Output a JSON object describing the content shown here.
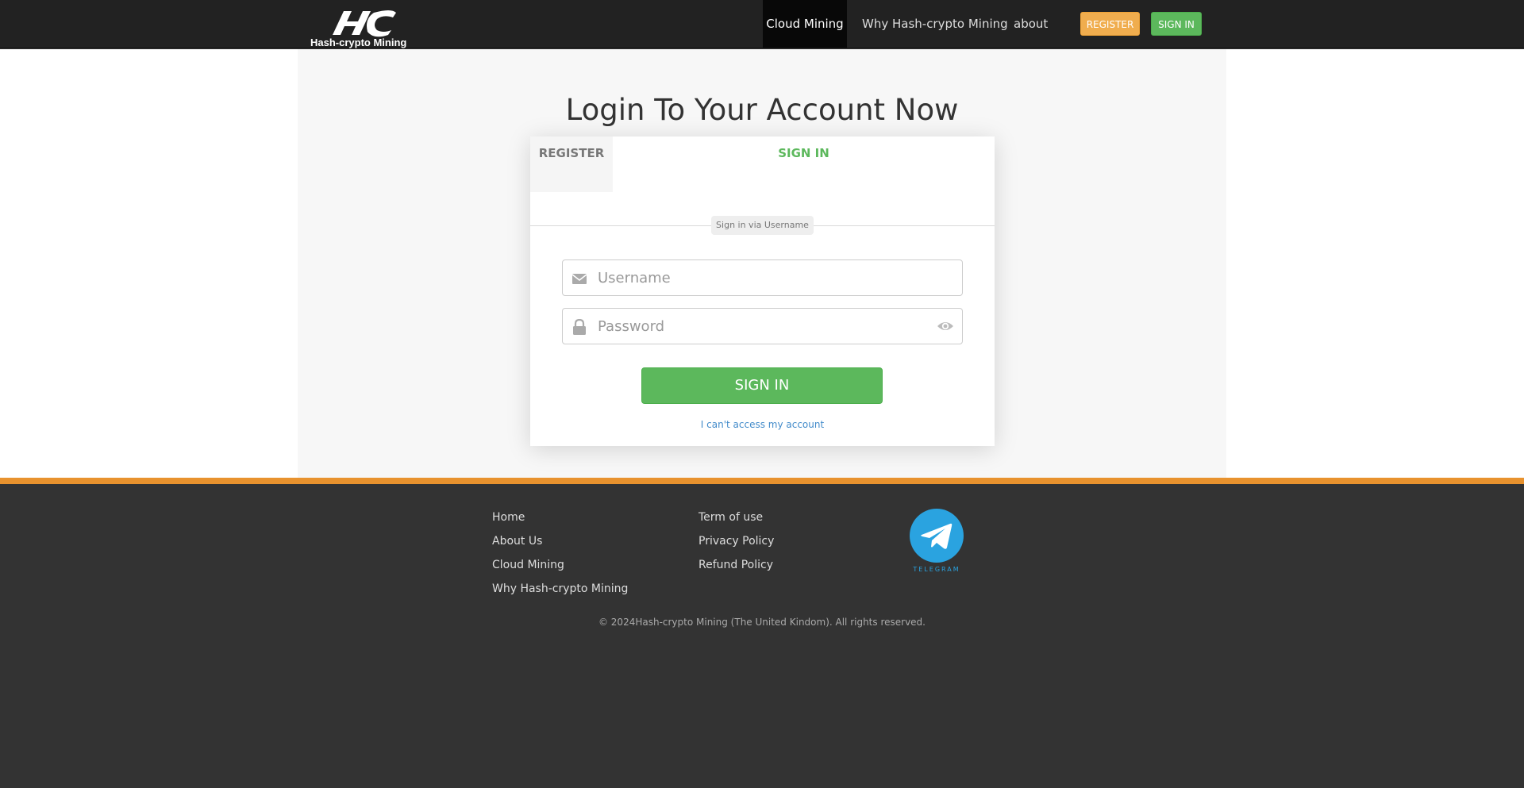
{
  "navbar": {
    "logo_text": "Hash-crypto  Mining",
    "items": [
      {
        "label": "Cloud Mining"
      },
      {
        "label": "Why Hash-crypto Mining"
      },
      {
        "label": "about"
      }
    ],
    "register_label": "REGISTER",
    "signin_label": "SIGN IN"
  },
  "main": {
    "title": "Login To Your Account Now",
    "tabs": {
      "register": "REGISTER",
      "signin": "SIGN IN"
    },
    "divider_label": "Sign in via Username",
    "username": {
      "placeholder": "Username",
      "value": ""
    },
    "password": {
      "placeholder": "Password",
      "value": ""
    },
    "submit_label": "SIGN IN",
    "access_link": "I can't access my account"
  },
  "footer": {
    "col1": [
      {
        "label": "Home"
      },
      {
        "label": "About Us"
      },
      {
        "label": "Cloud Mining"
      },
      {
        "label": "Why Hash-crypto Mining"
      }
    ],
    "col2": [
      {
        "label": "Term of use"
      },
      {
        "label": "Privacy Policy"
      },
      {
        "label": "Refund Policy"
      }
    ],
    "telegram_label": "TELEGRAM",
    "copyright": "© 2024Hash-crypto Mining (The United Kindom). All rights reserved."
  },
  "colors": {
    "nav_bg": "#222222",
    "accent_green": "#5cb85c",
    "accent_orange": "#f0ad4e",
    "footer_stripe": "#e8922e",
    "footer_bg": "#333333",
    "link_blue": "#428bca",
    "telegram_blue": "#2aa3e0"
  }
}
